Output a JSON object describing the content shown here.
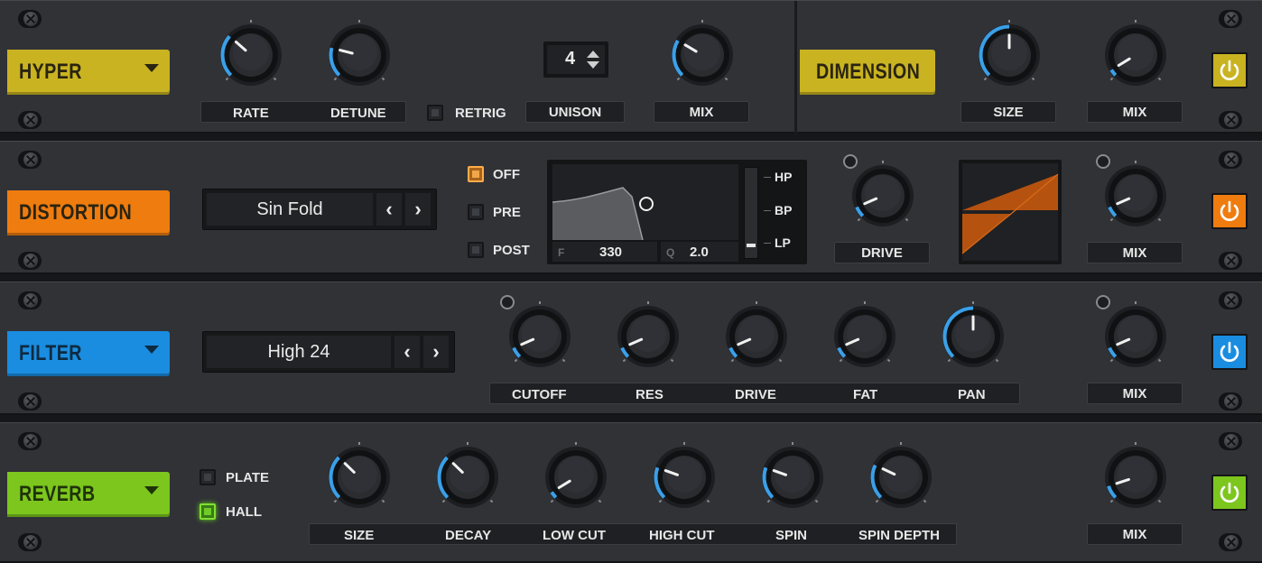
{
  "hyper": {
    "title": "HYPER",
    "color": "#c9b321",
    "rate_label": "RATE",
    "detune_label": "DETUNE",
    "retrig_label": "RETRIG",
    "unison_value": "4",
    "unison_label": "UNISON",
    "mix_label": "MIX"
  },
  "dimension": {
    "title": "DIMENSION",
    "size_label": "SIZE",
    "mix_label": "MIX"
  },
  "distortion": {
    "title": "DISTORTION",
    "color": "#ef7c0f",
    "type_value": "Sin Fold",
    "mode_off": "OFF",
    "mode_pre": "PRE",
    "mode_post": "POST",
    "filter_f_label": "F",
    "filter_f_value": "330",
    "filter_q_label": "Q",
    "filter_q_value": "2.0",
    "filter_hp": "HP",
    "filter_bp": "BP",
    "filter_lp": "LP",
    "drive_label": "DRIVE",
    "mix_label": "MIX"
  },
  "filter": {
    "title": "FILTER",
    "color": "#1a8de0",
    "type_value": "High 24",
    "cutoff_label": "CUTOFF",
    "res_label": "RES",
    "drive_label": "DRIVE",
    "fat_label": "FAT",
    "pan_label": "PAN",
    "mix_label": "MIX"
  },
  "reverb": {
    "title": "REVERB",
    "color": "#7cc61e",
    "plate_label": "PLATE",
    "hall_label": "HALL",
    "size_label": "SIZE",
    "decay_label": "DECAY",
    "lowcut_label": "LOW CUT",
    "highcut_label": "HIGH CUT",
    "spin_label": "SPIN",
    "spindepth_label": "SPIN DEPTH",
    "mix_label": "MIX"
  },
  "knobs": {
    "hyper_rate": 0.32,
    "hyper_detune": 0.22,
    "hyper_mix": 0.28,
    "dimension_size": 0.5,
    "dimension_mix": 0.05,
    "distortion_drive": 0.08,
    "distortion_mix": 0.08,
    "filter_cutoff": 0.08,
    "filter_res": 0.08,
    "filter_drive": 0.08,
    "filter_fat": 0.08,
    "filter_pan": 0.5,
    "filter_mix": 0.08,
    "reverb_size": 0.33,
    "reverb_decay": 0.33,
    "reverb_lowcut": 0.05,
    "reverb_highcut": 0.24,
    "reverb_spin": 0.24,
    "reverb_spindepth": 0.26,
    "reverb_mix": 0.1
  },
  "power_colors": {
    "hyper": "#c9b321",
    "distortion": "#ef7c0f",
    "filter": "#1a8de0",
    "reverb": "#7cc61e"
  },
  "accent": "#3aa0e8"
}
